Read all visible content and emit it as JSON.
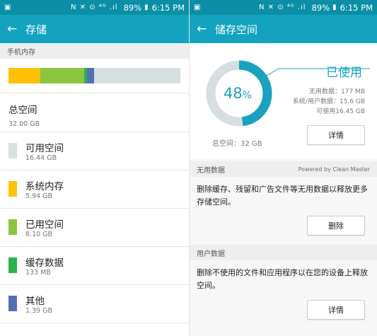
{
  "status_bar": {
    "left_icon": "picture-icon",
    "icons": "N ✕ ⊙ ⁴ᴳ .ıl",
    "battery": "89%",
    "time": "6:15 PM"
  },
  "left_pane": {
    "title": "存储",
    "section_header": "手机内存",
    "usage_bar": [
      {
        "color": "#ffc107",
        "fraction": 0.186
      },
      {
        "color": "#8bc53f",
        "fraction": 0.253
      },
      {
        "color": "#2bb24c",
        "fraction": 0.016
      },
      {
        "color": "#536fb4",
        "fraction": 0.044
      },
      {
        "color": "#d6dee0",
        "fraction": 0.501
      }
    ],
    "total": {
      "label": "总空间",
      "value": "32.00 GB"
    },
    "legend": [
      {
        "label": "可用空间",
        "value": "16.44 GB",
        "color": "#d9dfe1"
      },
      {
        "label": "系统内存",
        "value": "5.94 GB",
        "color": "#ffc107"
      },
      {
        "label": "已用空间",
        "value": "8.10 GB",
        "color": "#8bc53f"
      },
      {
        "label": "缓存数据",
        "value": "133 MB",
        "color": "#2bb24c"
      },
      {
        "label": "其他",
        "value": "1.39 GB",
        "color": "#536fb4"
      }
    ]
  },
  "right_pane": {
    "title": "储存空间",
    "donut": {
      "percent_value": 0.48,
      "number": "48",
      "unit": "%",
      "used_color": "#19a2bf",
      "free_color": "#d6dee0"
    },
    "used_label": "已使用",
    "details": [
      "无用数据：177 MB",
      "系统/用户数据：15.6 GB",
      "可使用16.45 GB"
    ],
    "total": "总空间：32 GB",
    "details_button": "详情",
    "junk": {
      "header": "无用数据",
      "powered": "Powered by Clean Master",
      "description": "删除缓存、残留和广告文件等无用数据以释放更多存储空间。",
      "button": "删除"
    },
    "user": {
      "header": "用户数据",
      "description": "删除不使用的文件和应用程序以在您的设备上释放空间。",
      "button": "详情"
    }
  }
}
